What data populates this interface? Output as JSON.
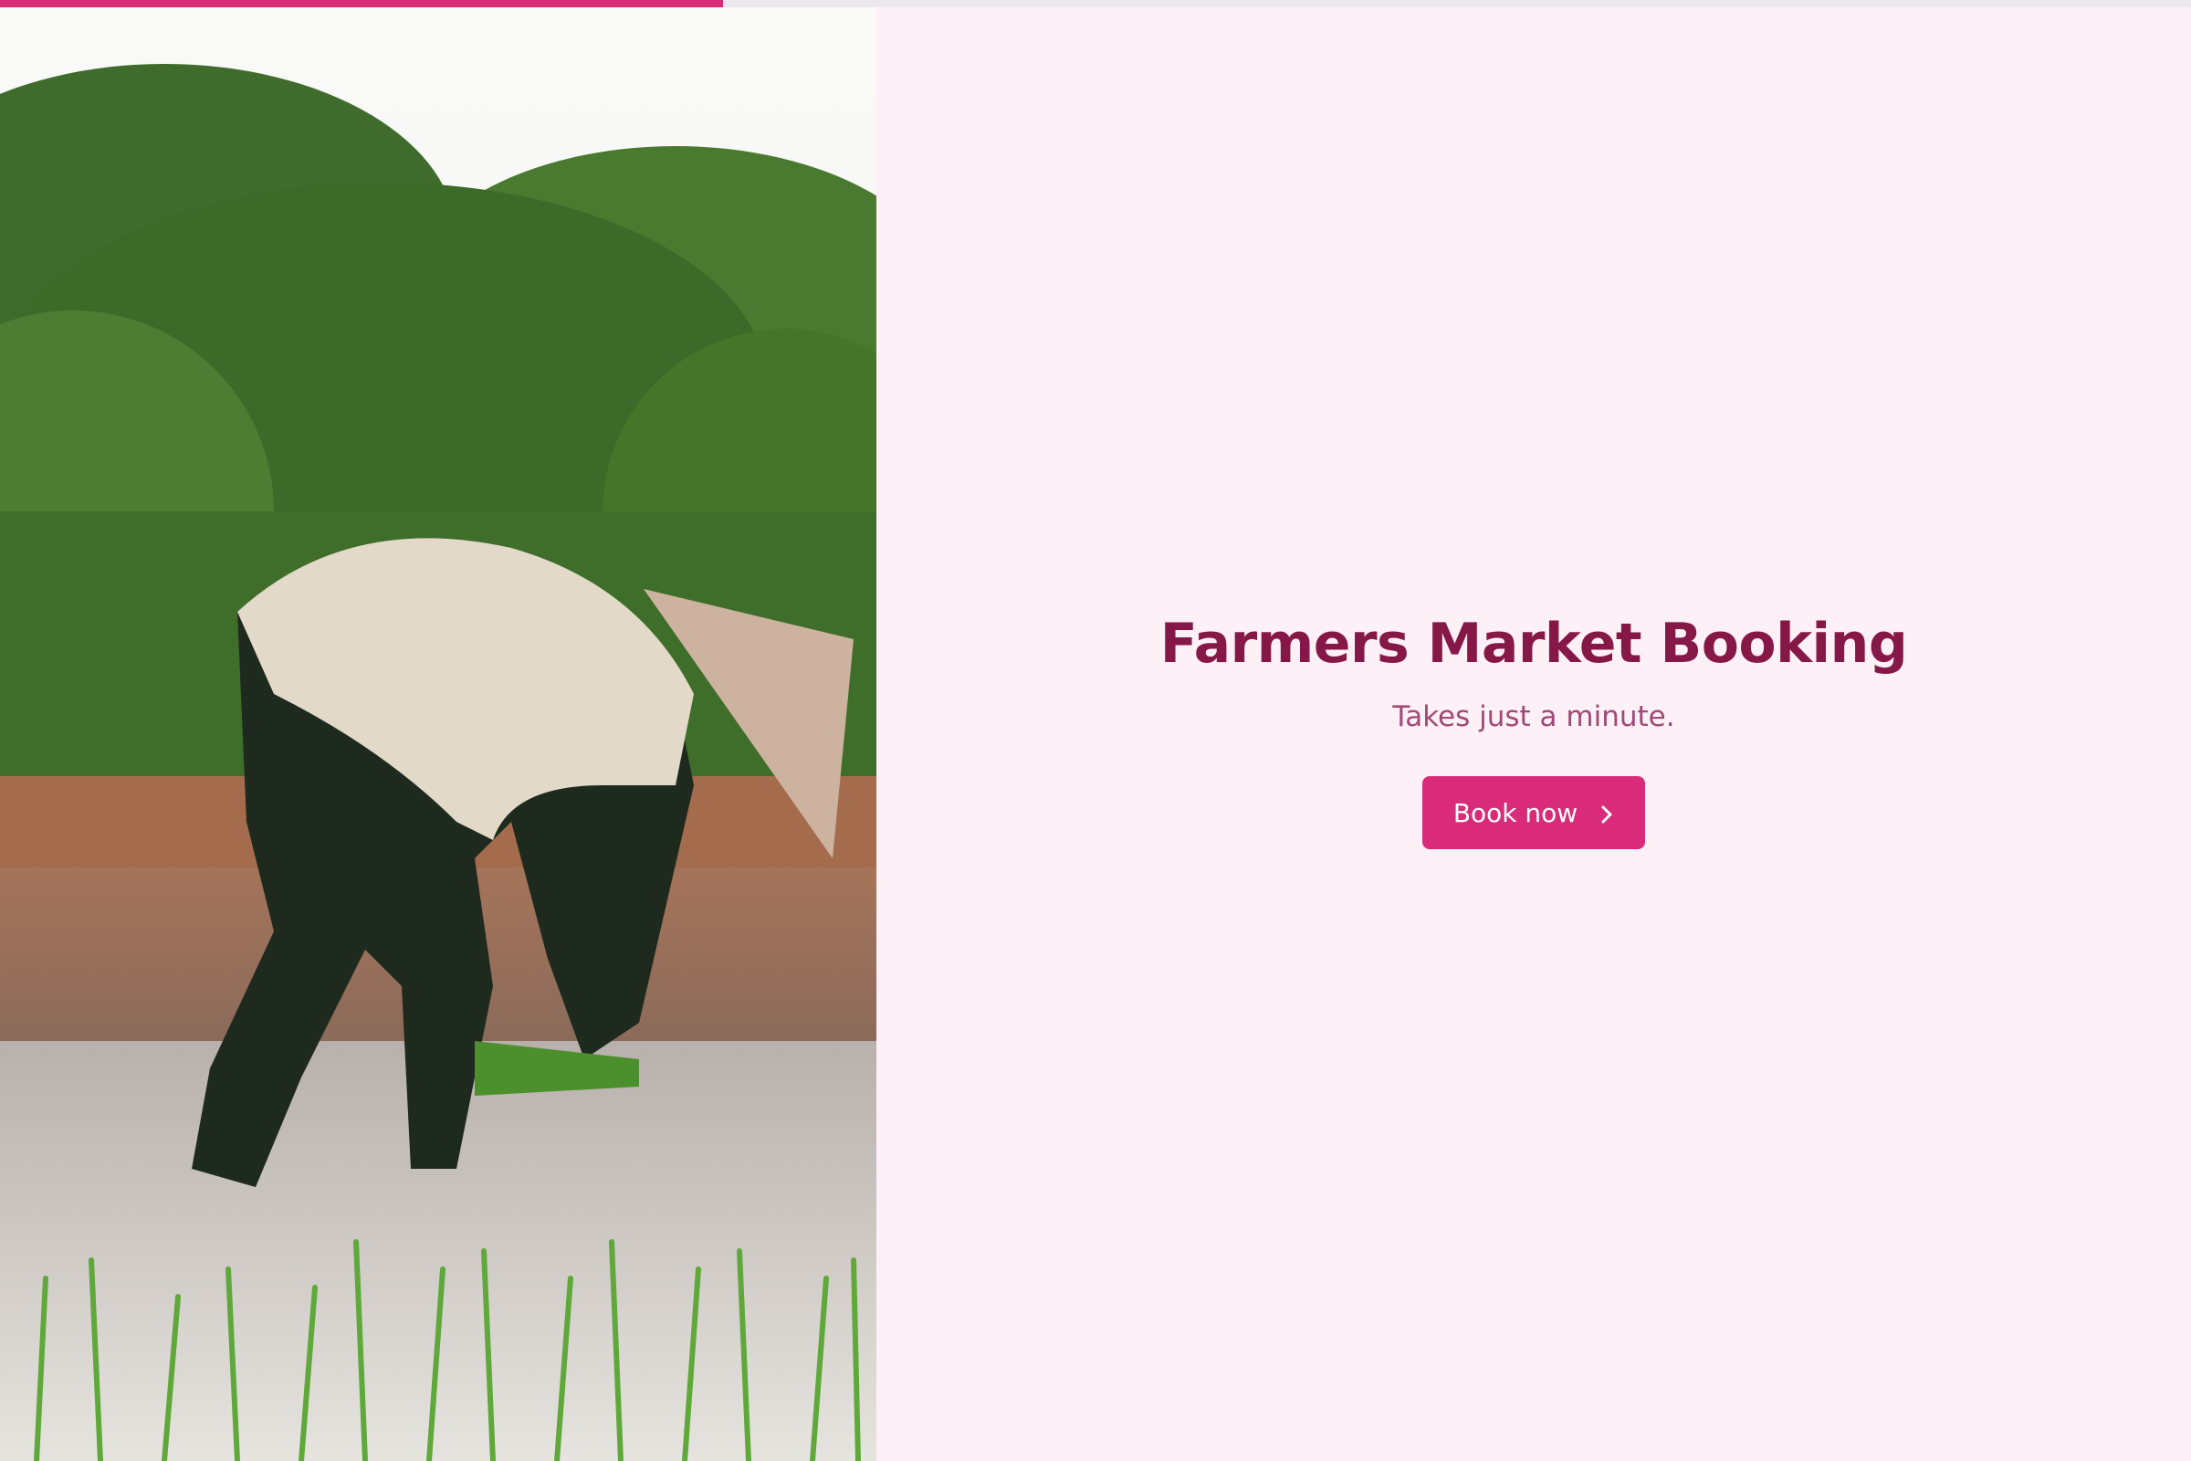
{
  "progress": {
    "fraction": 0.33
  },
  "hero": {
    "image_description": "photo-farmer-planting-rice-seedlings-in-paddy",
    "icon": "photo"
  },
  "booking": {
    "title": "Farmers Market Booking",
    "subtitle": "Takes just a minute.",
    "button_label": "Book now",
    "button_icon": "chevron-right-icon"
  },
  "colors": {
    "accent": "#d92b7a",
    "title": "#861848",
    "subtitle": "#a04a75",
    "background": "#fdf0f6"
  }
}
